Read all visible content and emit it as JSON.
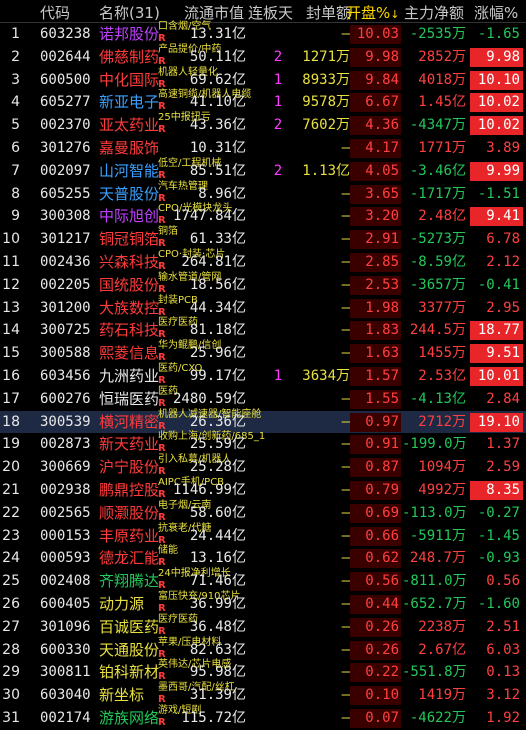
{
  "header": {
    "code": "代码",
    "name": "名称(31)",
    "float_cap": "流通市值",
    "days": "连板天",
    "seal": "封单额",
    "open": "开盘%",
    "net": "主力净额",
    "chg": "涨幅%"
  },
  "rows": [
    {
      "idx": "1",
      "code": "603238",
      "name": "诺邦股份",
      "nc": "n-pur",
      "tag": "口含烟/空气",
      "r": true,
      "float": "13.31亿",
      "days": "",
      "seal": "–",
      "open": "10.03",
      "net": "-2535万",
      "nd": "dn",
      "chg": "-1.65",
      "cd": "dn",
      "box": false
    },
    {
      "idx": "2",
      "code": "002644",
      "name": "佛慈制药",
      "nc": "n-red",
      "tag": "产品提价/中药",
      "r": true,
      "float": "50.11亿",
      "days": "2",
      "seal": "1271万",
      "open": "9.98",
      "net": "2852万",
      "nd": "up",
      "chg": "9.98",
      "cd": "up",
      "box": true
    },
    {
      "idx": "3",
      "code": "600500",
      "name": "中化国际",
      "nc": "n-red",
      "tag": "机器人轻量化",
      "r": true,
      "float": "69.62亿",
      "days": "1",
      "seal": "8933万",
      "open": "9.84",
      "net": "4018万",
      "nd": "up",
      "chg": "10.10",
      "cd": "up",
      "box": true
    },
    {
      "idx": "4",
      "code": "605277",
      "name": "新亚电子",
      "nc": "n-blu",
      "tag": "高速铜缆/机器人电缆",
      "r": true,
      "float": "41.10亿",
      "days": "1",
      "seal": "9578万",
      "open": "6.67",
      "net": "1.45亿",
      "nd": "up",
      "chg": "10.02",
      "cd": "up",
      "box": true
    },
    {
      "idx": "5",
      "code": "002370",
      "name": "亚太药业",
      "nc": "n-red",
      "tag": "25中报扭亏",
      "r": true,
      "float": "43.36亿",
      "days": "2",
      "seal": "7602万",
      "open": "4.36",
      "net": "-4347万",
      "nd": "dn",
      "chg": "10.02",
      "cd": "up",
      "box": true
    },
    {
      "idx": "6",
      "code": "301276",
      "name": "嘉曼服饰",
      "nc": "n-red",
      "tag": "",
      "r": false,
      "float": "10.31亿",
      "days": "",
      "seal": "–",
      "open": "4.17",
      "net": "1771万",
      "nd": "up",
      "chg": "3.89",
      "cd": "up",
      "box": false
    },
    {
      "idx": "7",
      "code": "002097",
      "name": "山河智能",
      "nc": "n-blu",
      "tag": "低空/工程机械",
      "r": true,
      "float": "85.51亿",
      "days": "2",
      "seal": "1.13亿",
      "open": "4.05",
      "net": "-3.46亿",
      "nd": "dn",
      "chg": "9.99",
      "cd": "up",
      "box": true
    },
    {
      "idx": "8",
      "code": "605255",
      "name": "天普股份",
      "nc": "n-blu",
      "tag": "汽车热管理",
      "r": true,
      "float": "8.96亿",
      "days": "",
      "seal": "–",
      "open": "3.65",
      "net": "-1717万",
      "nd": "dn",
      "chg": "-1.51",
      "cd": "dn",
      "box": false
    },
    {
      "idx": "9",
      "code": "300308",
      "name": "中际旭创",
      "nc": "n-pur",
      "tag": "CPO/光模块龙头",
      "r": true,
      "float": "1747.84亿",
      "days": "",
      "seal": "–",
      "open": "3.20",
      "net": "2.48亿",
      "nd": "up",
      "chg": "9.41",
      "cd": "up",
      "box": true
    },
    {
      "idx": "10",
      "code": "301217",
      "name": "铜冠铜箔",
      "nc": "n-red",
      "tag": "铜箔",
      "r": true,
      "float": "61.33亿",
      "days": "",
      "seal": "–",
      "open": "2.91",
      "net": "-5273万",
      "nd": "dn",
      "chg": "6.78",
      "cd": "up",
      "box": false
    },
    {
      "idx": "11",
      "code": "002436",
      "name": "兴森科技",
      "nc": "n-red",
      "tag": "CPO·封装·芯片",
      "r": true,
      "float": "264.81亿",
      "days": "",
      "seal": "–",
      "open": "2.85",
      "net": "-8.59亿",
      "nd": "dn",
      "chg": "2.12",
      "cd": "up",
      "box": false
    },
    {
      "idx": "12",
      "code": "002205",
      "name": "国统股份",
      "nc": "n-red",
      "tag": "输水管道/管网",
      "r": true,
      "float": "18.56亿",
      "days": "",
      "seal": "–",
      "open": "2.53",
      "net": "-3657万",
      "nd": "dn",
      "chg": "-0.41",
      "cd": "dn",
      "box": false
    },
    {
      "idx": "13",
      "code": "301200",
      "name": "大族数控",
      "nc": "n-red",
      "tag": "封装PCB",
      "r": true,
      "float": "44.34亿",
      "days": "",
      "seal": "–",
      "open": "1.98",
      "net": "3377万",
      "nd": "up",
      "chg": "2.95",
      "cd": "up",
      "box": false
    },
    {
      "idx": "14",
      "code": "300725",
      "name": "药石科技",
      "nc": "n-red",
      "tag": "医疗医药",
      "r": true,
      "float": "81.18亿",
      "days": "",
      "seal": "–",
      "open": "1.83",
      "net": "244.5万",
      "nd": "up",
      "chg": "18.77",
      "cd": "up",
      "box": true
    },
    {
      "idx": "15",
      "code": "300588",
      "name": "熙菱信息",
      "nc": "n-red",
      "tag": "华为鲲鹏/信创",
      "r": true,
      "float": "25.96亿",
      "days": "",
      "seal": "–",
      "open": "1.63",
      "net": "1455万",
      "nd": "up",
      "chg": "9.51",
      "cd": "up",
      "box": true
    },
    {
      "idx": "16",
      "code": "603456",
      "name": "九洲药业",
      "nc": "n-wht",
      "tag": "医药/CXO",
      "r": true,
      "float": "99.17亿",
      "days": "1",
      "seal": "3634万",
      "open": "1.57",
      "net": "2.53亿",
      "nd": "up",
      "chg": "10.01",
      "cd": "up",
      "box": true
    },
    {
      "idx": "17",
      "code": "600276",
      "name": "恒瑞医药",
      "nc": "n-wht",
      "tag": "医药",
      "r": true,
      "float": "2480.59亿",
      "days": "",
      "seal": "–",
      "open": "1.55",
      "net": "-4.13亿",
      "nd": "dn",
      "chg": "2.84",
      "cd": "up",
      "box": false
    },
    {
      "idx": "18",
      "code": "300539",
      "name": "横河精密",
      "nc": "n-red",
      "tag": "机器人减速器/智能座舱",
      "r": true,
      "float": "26.36亿",
      "days": "",
      "seal": "–",
      "open": "0.97",
      "net": "2712万",
      "nd": "up",
      "chg": "19.10",
      "cd": "up",
      "box": true,
      "sel": true
    },
    {
      "idx": "19",
      "code": "002873",
      "name": "新天药业",
      "nc": "n-red",
      "tag": "收购上海/创新药/685_1",
      "r": true,
      "float": "25.59亿",
      "days": "",
      "seal": "–",
      "open": "0.91",
      "net": "-199.0万",
      "nd": "dn",
      "chg": "1.37",
      "cd": "up",
      "box": false
    },
    {
      "idx": "20",
      "code": "300669",
      "name": "沪宁股份",
      "nc": "n-red",
      "tag": "引入私募/机器人",
      "r": true,
      "float": "25.28亿",
      "days": "",
      "seal": "–",
      "open": "0.87",
      "net": "1094万",
      "nd": "up",
      "chg": "2.59",
      "cd": "up",
      "box": false
    },
    {
      "idx": "21",
      "code": "002938",
      "name": "鹏鼎控股",
      "nc": "n-red",
      "tag": "AIPC手机/PCB",
      "r": true,
      "float": "1146.99亿",
      "days": "",
      "seal": "–",
      "open": "0.79",
      "net": "4992万",
      "nd": "up",
      "chg": "8.35",
      "cd": "up",
      "box": true
    },
    {
      "idx": "22",
      "code": "002565",
      "name": "顺灏股份",
      "nc": "n-red",
      "tag": "电子烟/云南",
      "r": true,
      "float": "58.60亿",
      "days": "",
      "seal": "–",
      "open": "0.69",
      "net": "-113.0万",
      "nd": "dn",
      "chg": "-0.27",
      "cd": "dn",
      "box": false
    },
    {
      "idx": "23",
      "code": "000153",
      "name": "丰原药业",
      "nc": "n-red",
      "tag": "抗衰老/代糖",
      "r": true,
      "float": "24.44亿",
      "days": "",
      "seal": "–",
      "open": "0.66",
      "net": "-5911万",
      "nd": "dn",
      "chg": "-1.45",
      "cd": "dn",
      "box": false
    },
    {
      "idx": "24",
      "code": "000593",
      "name": "德龙汇能",
      "nc": "n-red",
      "tag": "储能",
      "r": true,
      "float": "13.16亿",
      "days": "",
      "seal": "–",
      "open": "0.62",
      "net": "248.7万",
      "nd": "up",
      "chg": "-0.93",
      "cd": "dn",
      "box": false
    },
    {
      "idx": "25",
      "code": "002408",
      "name": "齐翔腾达",
      "nc": "n-grn",
      "tag": "24中报净利增长",
      "r": true,
      "float": "71.46亿",
      "days": "",
      "seal": "–",
      "open": "0.56",
      "net": "-811.0万",
      "nd": "dn",
      "chg": "0.56",
      "cd": "up",
      "box": false
    },
    {
      "idx": "26",
      "code": "600405",
      "name": "动力源",
      "nc": "n-yel",
      "tag": "富压快充/910芯片",
      "r": true,
      "float": "36.99亿",
      "days": "",
      "seal": "–",
      "open": "0.44",
      "net": "-652.7万",
      "nd": "dn",
      "chg": "-1.60",
      "cd": "dn",
      "box": false
    },
    {
      "idx": "27",
      "code": "301096",
      "name": "百诚医药",
      "nc": "n-yel",
      "tag": "医疗医药",
      "r": true,
      "float": "36.48亿",
      "days": "",
      "seal": "–",
      "open": "0.26",
      "net": "2238万",
      "nd": "up",
      "chg": "2.51",
      "cd": "up",
      "box": false
    },
    {
      "idx": "28",
      "code": "600330",
      "name": "天通股份",
      "nc": "n-yel",
      "tag": "苹果/压电材料",
      "r": true,
      "float": "82.63亿",
      "days": "",
      "seal": "–",
      "open": "0.26",
      "net": "2.67亿",
      "nd": "up",
      "chg": "6.03",
      "cd": "up",
      "box": false
    },
    {
      "idx": "29",
      "code": "300811",
      "name": "铂科新材",
      "nc": "n-yel",
      "tag": "英伟达/芯片电感",
      "r": true,
      "float": "95.98亿",
      "days": "",
      "seal": "–",
      "open": "0.22",
      "net": "-551.8万",
      "nd": "dn",
      "chg": "0.13",
      "cd": "up",
      "box": false
    },
    {
      "idx": "30",
      "code": "603040",
      "name": "新坐标",
      "nc": "n-yel",
      "tag": "墨西哥/汽配/丝杠",
      "r": true,
      "float": "31.39亿",
      "days": "",
      "seal": "–",
      "open": "0.10",
      "net": "1419万",
      "nd": "up",
      "chg": "3.12",
      "cd": "up",
      "box": false
    },
    {
      "idx": "31",
      "code": "002174",
      "name": "游族网络",
      "nc": "n-grn",
      "tag": "游戏/短剧",
      "r": true,
      "float": "115.72亿",
      "days": "",
      "seal": "–",
      "open": "0.07",
      "net": "-4622万",
      "nd": "dn",
      "chg": "1.92",
      "cd": "up",
      "box": false
    }
  ]
}
